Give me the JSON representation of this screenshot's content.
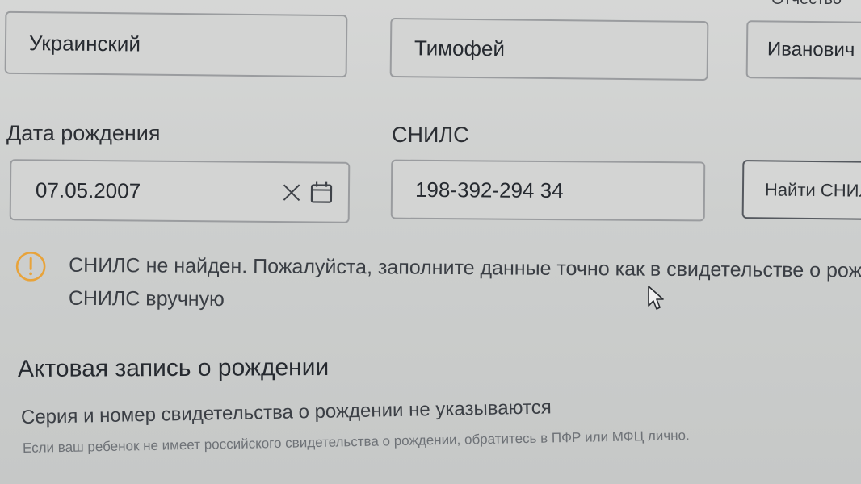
{
  "header": {
    "top_fragment": "Отчество"
  },
  "fields": {
    "last_name": {
      "value": "Украинский"
    },
    "first_name": {
      "value": "Тимофей"
    },
    "middle_name": {
      "value": "Иванович"
    }
  },
  "birth_date": {
    "label": "Дата рождения",
    "value": "07.05.2007"
  },
  "snils": {
    "label": "СНИЛС",
    "value": "198-392-294 34",
    "find_button": "Найти СНИЛС"
  },
  "warning": {
    "line1": "СНИЛС не найден. Пожалуйста, заполните данные точно как в свидетельстве о рождении",
    "line2": "СНИЛС вручную",
    "icon": "exclamation-circle-icon",
    "color": "#e8a33a"
  },
  "birth_record": {
    "title": "Актовая запись о рождении",
    "note": "Серия и номер свидетельства о рождении не указываются",
    "subnote": "Если ваш ребенок не имеет российского свидетельства о рождении, обратитесь в ПФР или МФЦ лично."
  },
  "icons": [
    "close-icon",
    "calendar-icon",
    "exclamation-circle-icon",
    "mouse-pointer-icon"
  ]
}
